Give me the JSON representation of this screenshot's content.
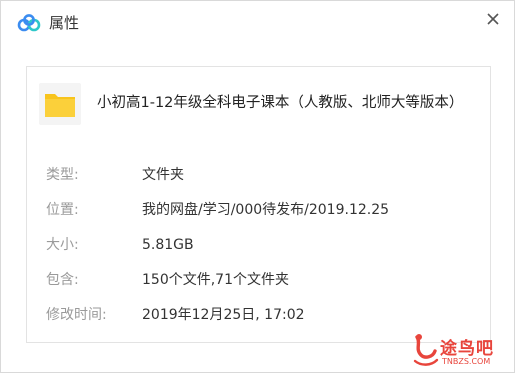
{
  "window": {
    "title": "属性",
    "app_icon": "baidu-netdisk-logo-icon",
    "close_icon": "close-icon"
  },
  "file": {
    "icon": "folder-icon",
    "name": "小初高1-12年级全科电子课本（人教版、北师大等版本）"
  },
  "properties": [
    {
      "label": "类型:",
      "value": "文件夹"
    },
    {
      "label": "位置:",
      "value": "我的网盘/学习/000待发布/2019.12.25"
    },
    {
      "label": "大小:",
      "value": "5.81GB"
    },
    {
      "label": "包含:",
      "value": "150个文件,71个文件夹"
    },
    {
      "label": "修改时间:",
      "value": "2019年12月25日, 17:02"
    }
  ],
  "watermark": {
    "text": "途鸟吧",
    "subtext": "TNBZS.COM"
  },
  "colors": {
    "logo_blue": "#3b8cf0",
    "logo_teal": "#2ec7c9",
    "folder_yellow": "#f8c41c",
    "label_gray": "#9a9a9a",
    "watermark_red": "#e8453c"
  }
}
